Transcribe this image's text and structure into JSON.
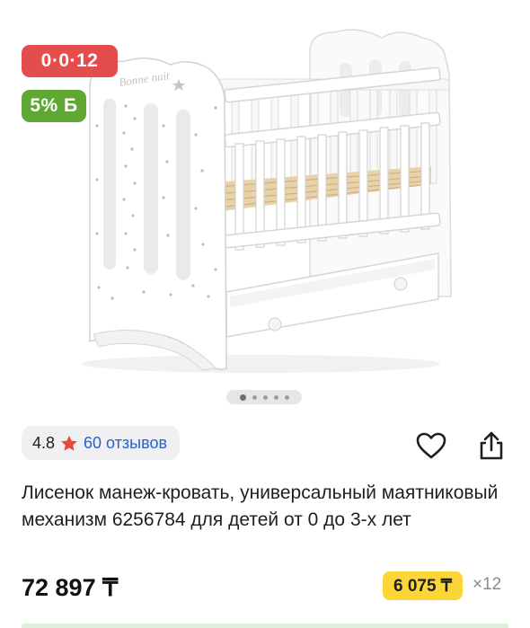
{
  "badges": {
    "installment": "0·0·12",
    "bonus": "5% Б"
  },
  "product_image": {
    "subject": "white baby crib with drawer",
    "engraving": "Bonne nuit",
    "slides_count": 5,
    "active_slide": 1
  },
  "rating": {
    "value": "4.8",
    "reviews": "60 отзывов",
    "star_color": "#e8473c"
  },
  "actions": {
    "favorite_icon": "heart-icon",
    "share_icon": "share-icon"
  },
  "product": {
    "title": "Лисенок манеж-кровать, универсальный маятниковый механизм 6256784 для детей от 0 до 3-х лет",
    "price": "72 897 ₸",
    "monthly_payment": "6 075 ₸",
    "months": "×12"
  },
  "colors": {
    "installment_badge": "#e34d4d",
    "bonus_badge": "#5fa833",
    "monthly_chip": "#fcd536",
    "link": "#2b61c9"
  }
}
